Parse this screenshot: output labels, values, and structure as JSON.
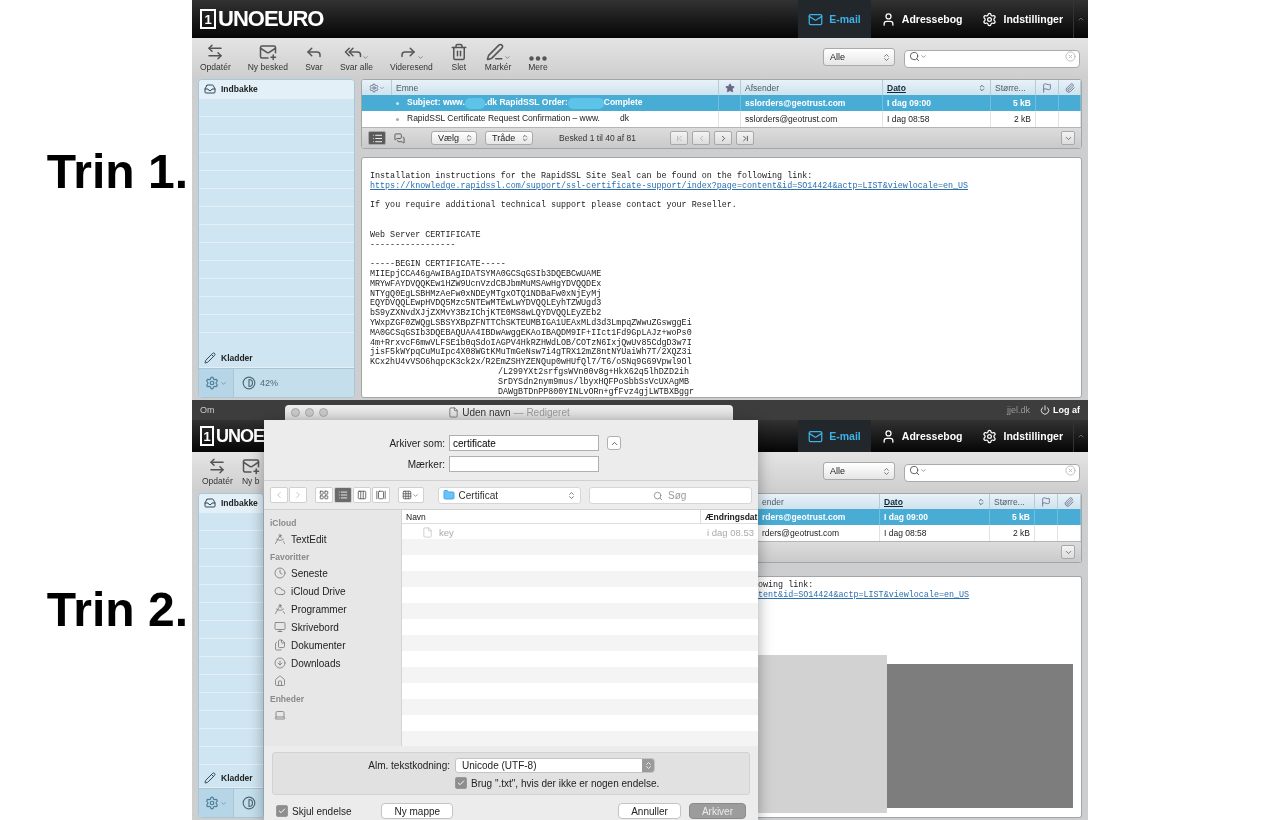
{
  "steps": [
    {
      "label": "Trin 1."
    },
    {
      "label": "Trin 2."
    }
  ],
  "step1": {
    "logo": {
      "mark": "1",
      "name": "UNOEURO"
    },
    "nav": [
      {
        "label": "E-mail",
        "selected": true
      },
      {
        "label": "Adressebog",
        "selected": false
      },
      {
        "label": "Indstillinger",
        "selected": false
      }
    ],
    "toolbar": [
      {
        "label": "Opdatér",
        "menu": false
      },
      {
        "label": "Ny besked",
        "menu": false
      },
      {
        "label": "Svar",
        "menu": false
      },
      {
        "label": "Svar alle",
        "menu": true
      },
      {
        "label": "Videresend",
        "menu": true
      },
      {
        "label": "Slet",
        "menu": false
      },
      {
        "label": "Markér",
        "menu": true
      },
      {
        "label": "Mere",
        "menu": false
      }
    ],
    "filter": "Alle",
    "sidebar": {
      "folders": [
        {
          "label": "Indbakke",
          "selected": true
        },
        {
          "label": "Kladder",
          "selected": false
        }
      ],
      "quota": "42%"
    },
    "list": {
      "columns": [
        {
          "label": "Emne",
          "sorted": false
        },
        {
          "label": "Afsender",
          "sorted": false
        },
        {
          "label": "Dato",
          "sorted": true
        },
        {
          "label": "Større...",
          "sorted": false
        }
      ],
      "rows": [
        {
          "subject": [
            "Subject: www.",
            ".dk RapidSSL Order:",
            "Complete"
          ],
          "sender": "sslorders@geotrust.com",
          "date": "I dag 09:00",
          "size": "5 kB",
          "selected": true
        },
        {
          "subject": [
            "RapidSSL Certificate Request Confirmation – www.",
            "dk"
          ],
          "sender": "sslorders@geotrust.com",
          "date": "I dag 08:58",
          "size": "2 kB",
          "selected": false
        }
      ],
      "view_select": "Vælg",
      "thread_select": "Tråde",
      "count": "Besked 1 til 40 af 81"
    },
    "preview": {
      "lines": [
        {
          "kind": "text",
          "text": "Installation instructions for the RapidSSL Site Seal can be found on the following link:"
        },
        {
          "kind": "link",
          "text": "https://knowledge.rapidssl.com/support/ssl-certificate-support/index?page=content&id=SO14424&actp=LIST&viewlocale=en_US"
        },
        {
          "kind": "gap"
        },
        {
          "kind": "text",
          "text": "If you require additional technical support please contact your Reseller."
        },
        {
          "kind": "gap"
        },
        {
          "kind": "gap"
        },
        {
          "kind": "text",
          "text": "Web Server CERTIFICATE"
        },
        {
          "kind": "text",
          "text": "-----------------"
        },
        {
          "kind": "gap"
        },
        {
          "kind": "text",
          "text": "-----BEGIN CERTIFICATE-----"
        },
        {
          "kind": "text",
          "text": "MIIEpjCCA46gAwIBAgIDATSYMA0GCSqGSIb3DQEBCwUAME"
        },
        {
          "kind": "text",
          "text": "MRYwFAYDVQQKEw1HZW9UcnVzdCBJbmMuMSAwHgYDVQQDEx"
        },
        {
          "kind": "text",
          "text": "NTYgQ0EgLSBHMzAeFw0xNDEyMTgxOTQ1NDBaFw0xNjEyMj"
        },
        {
          "kind": "text",
          "text": "EQYDVQQLEwpHVDQ5Mzc5NTEwMTEwLwYDVQQLEyhTZWUgd3"
        },
        {
          "kind": "text",
          "text": "bS9yZXNvdXJjZXMvY3BzIChjKTE0MS8wLQYDVQQLEyZEb2"
        },
        {
          "kind": "text",
          "text": "YWxpZGF0ZWQgLSBSYXBpZFNTTChSKTEUMBIGA1UEAxMLd3d3LmpqZWwuZGswggEi"
        },
        {
          "kind": "text",
          "text": "MA0GCSqGSIb3DQEBAQUAA4IBDwAwggEKAoIBAQDM9IF+IIct1Fd9GpLAJz+woPs0"
        },
        {
          "kind": "text",
          "text": "4m+RrxvcF6mwVLFSE1b0qSdoIAGPV4HkRZHWdLOB/COTzN6IxjQwUv85CdgD3w7I"
        },
        {
          "kind": "text",
          "text": "jisF5kWYpqCuMuIpc4X08WGtKMuTmGeNsw7i4gTRX12mZ8ntNYUaiWh7T/2XQZ3i"
        },
        {
          "kind": "text",
          "text": "KCx2hU4vVSO6hqpcK3ck2x/R2EmZSHYZENQup0wHUfQl7/T6/oSNq9G69Vpwl9Ol"
        },
        {
          "kind": "indented",
          "text": "/L299YXt2srfgsWVn00v8g+HkX62q5lhDZD2ih"
        },
        {
          "kind": "indented",
          "text": "SrDYSdn2nym9mus/lbyxHQFPoSbbSsVcUXAgMB"
        },
        {
          "kind": "indented",
          "text": "DAWgBTDnPP800YINLvORn+gfFvz4gjLWTBXBggr"
        }
      ]
    }
  },
  "step2": {
    "top_bar": {
      "label": "Om",
      "user": "jjel.dk",
      "logout": "Log af"
    },
    "logo": {
      "mark": "1",
      "name": "UNOE"
    },
    "nav": [
      {
        "label": "E-mail",
        "selected": true
      },
      {
        "label": "Adressebog",
        "selected": false
      },
      {
        "label": "Indstillinger",
        "selected": false
      }
    ],
    "toolbar": [
      {
        "label": "Opdatér"
      },
      {
        "label": "Ny b"
      }
    ],
    "filter": "Alle",
    "sidebar": {
      "folders": [
        {
          "label": "Indbakke",
          "selected": true
        },
        {
          "label": "Kladder",
          "selected": false
        }
      ]
    },
    "list": {
      "columns": [
        {
          "label": "ender",
          "sorted": false
        },
        {
          "label": "Dato",
          "sorted": true
        },
        {
          "label": "Større...",
          "sorted": false
        }
      ],
      "rows": [
        {
          "sender": "rders@geotrust.com",
          "date": "I dag 09:00",
          "size": "5 kB",
          "selected": true
        },
        {
          "sender": "rders@geotrust.com",
          "date": "I dag 08:58",
          "size": "2 kB",
          "selected": false
        }
      ]
    },
    "preview": {
      "lines": [
        {
          "kind": "text",
          "text": "owing link:"
        },
        {
          "kind": "link",
          "text": "tent&id=SO14424&actp=LIST&viewlocale=en_US"
        }
      ]
    }
  },
  "dialog": {
    "window_title": "Uden navn",
    "window_state": "— Redigeret",
    "save_as_label": "Arkiver som:",
    "save_as_value": "certificate",
    "tags_label": "Mærker:",
    "views": [
      {
        "selected": false
      },
      {
        "selected": true
      },
      {
        "selected": false
      },
      {
        "selected": false
      }
    ],
    "location": "Certificat",
    "search_placeholder": "Søg",
    "sidebar": [
      {
        "heading": "iCloud",
        "items": [
          {
            "label": "TextEdit"
          }
        ]
      },
      {
        "heading": "Favoritter",
        "items": [
          {
            "label": "Seneste"
          },
          {
            "label": "iCloud Drive"
          },
          {
            "label": "Programmer"
          },
          {
            "label": "Skrivebord"
          },
          {
            "label": "Dokumenter"
          },
          {
            "label": "Downloads"
          }
        ]
      },
      {
        "heading": "Enheder"
      }
    ],
    "columns": [
      "Navn",
      "Ændringsdat"
    ],
    "files": [
      {
        "name": "key",
        "date": "i dag 08.53",
        "disabled": true
      }
    ],
    "encoding_label": "Alm. tekstkodning:",
    "encoding": "Unicode (UTF-8)",
    "use_txt": {
      "label": "Brug \".txt\", hvis der ikke er nogen endelse.",
      "checked": true
    },
    "hide_ext": {
      "label": "Skjul endelse",
      "checked": true
    },
    "buttons": [
      {
        "label": "Ny mappe",
        "disabled": false
      },
      {
        "label": "Annuller",
        "disabled": false
      },
      {
        "label": "Arkiver",
        "disabled": true
      }
    ]
  }
}
